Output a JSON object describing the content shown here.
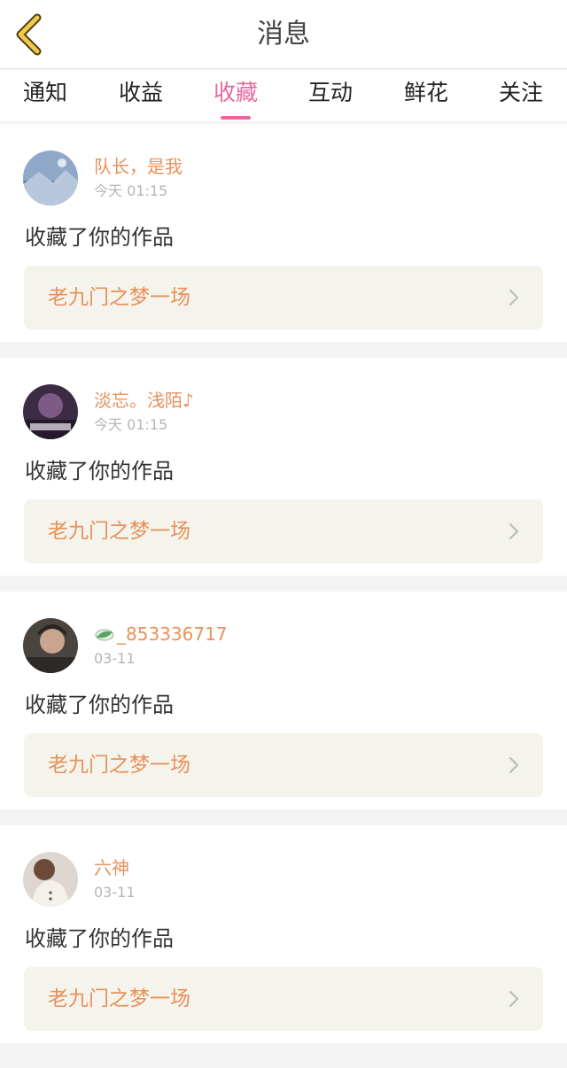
{
  "header": {
    "title": "消息"
  },
  "tabs": [
    {
      "label": "通知"
    },
    {
      "label": "收益"
    },
    {
      "label": "收藏",
      "active": true
    },
    {
      "label": "互动"
    },
    {
      "label": "鲜花"
    },
    {
      "label": "关注"
    }
  ],
  "messages": [
    {
      "user": "队长，是我",
      "time": "今天 01:15",
      "action": "收藏了你的作品",
      "work": "老九门之梦一场"
    },
    {
      "user": "淡忘。浅陌♪",
      "time": "今天 01:15",
      "action": "收藏了你的作品",
      "work": "老九门之梦一场"
    },
    {
      "user": "_853336717",
      "time": "03-11",
      "action": "收藏了你的作品",
      "work": "老九门之梦一场"
    },
    {
      "user": "六神",
      "time": "03-11",
      "action": "收藏了你的作品",
      "work": "老九门之梦一场"
    }
  ],
  "colors": {
    "accent": "#e9679f",
    "username": "#e8915a",
    "back_arrow": "#f2c94c"
  }
}
